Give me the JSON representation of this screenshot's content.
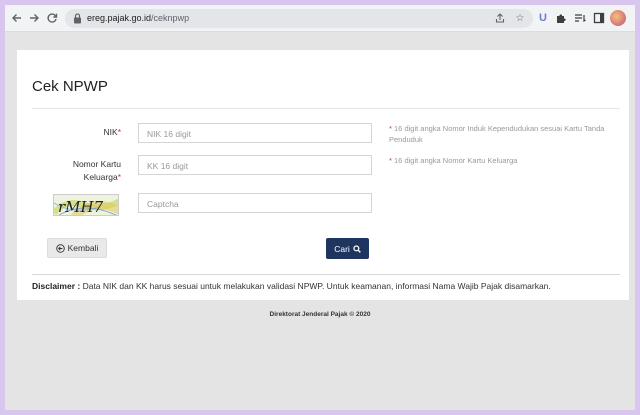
{
  "browser": {
    "url_domain": "ereg.pajak.go.id",
    "url_path": "/ceknpwp",
    "ext_letter": "U"
  },
  "page": {
    "title": "Cek NPWP"
  },
  "form": {
    "nik_label": "NIK",
    "nik_placeholder": "NIK 16 digit",
    "nik_hint": "16 digit angka Nomor Induk Kependudukan sesuai Kartu Tanda Penduduk",
    "kk_label_line1": "Nomor Kartu",
    "kk_label_line2": "Keluarga",
    "kk_placeholder": "KK 16 digit",
    "kk_hint": "16 digit angka Nomor Kartu Keluarga",
    "captcha_placeholder": "Captcha",
    "captcha_text": "rMH7",
    "required_mark": "*"
  },
  "buttons": {
    "back_label": "Kembali",
    "search_label": "Cari"
  },
  "disclaimer": {
    "heading": "Disclaimer :",
    "text": "Data NIK dan KK harus sesuai untuk melakukan validasi NPWP. Untuk keamanan, informasi Nama Wajib Pajak disamarkan."
  },
  "footer": {
    "text": "Direktorat Jenderal Pajak © 2020"
  },
  "colors": {
    "primary_button": "#1e3560",
    "required": "#c0392b",
    "outer_frame": "#d9c6ee"
  }
}
